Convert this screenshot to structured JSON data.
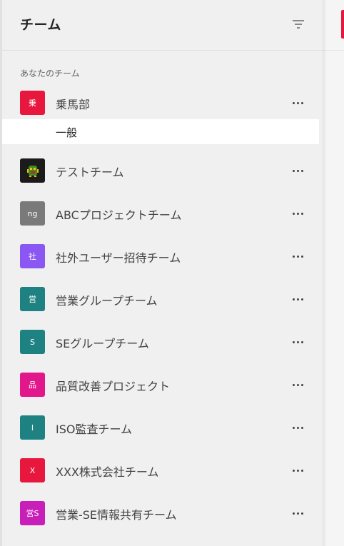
{
  "header": {
    "title": "チーム"
  },
  "section": {
    "label": "あなたのチーム"
  },
  "teams": [
    {
      "name": "乗馬部",
      "avatar_text": "乗",
      "color": "#e8173d"
    },
    {
      "name": "テストチーム",
      "avatar_text": "",
      "color": "#1b1b1b",
      "avatar_icon": "bug-mascot-icon"
    },
    {
      "name": "ABCプロジェクトチーム",
      "avatar_text": "ng",
      "color": "#7a7a7a"
    },
    {
      "name": "社外ユーザー招待チーム",
      "avatar_text": "社",
      "color": "#8a57f3"
    },
    {
      "name": "営業グループチーム",
      "avatar_text": "営",
      "color": "#1f8282"
    },
    {
      "name": "SEグループチーム",
      "avatar_text": "S",
      "color": "#1f8282"
    },
    {
      "name": "品質改善プロジェクト",
      "avatar_text": "品",
      "color": "#e3178c"
    },
    {
      "name": "ISO監査チーム",
      "avatar_text": "I",
      "color": "#1f8282"
    },
    {
      "name": "XXX株式会社チーム",
      "avatar_text": "X",
      "color": "#e8173d"
    },
    {
      "name": "営業-SE情報共有チーム",
      "avatar_text": "営S",
      "color": "#c71fb8"
    }
  ],
  "channels": [
    {
      "name": "一般"
    }
  ],
  "colors": {
    "accent": "#e8173d"
  }
}
